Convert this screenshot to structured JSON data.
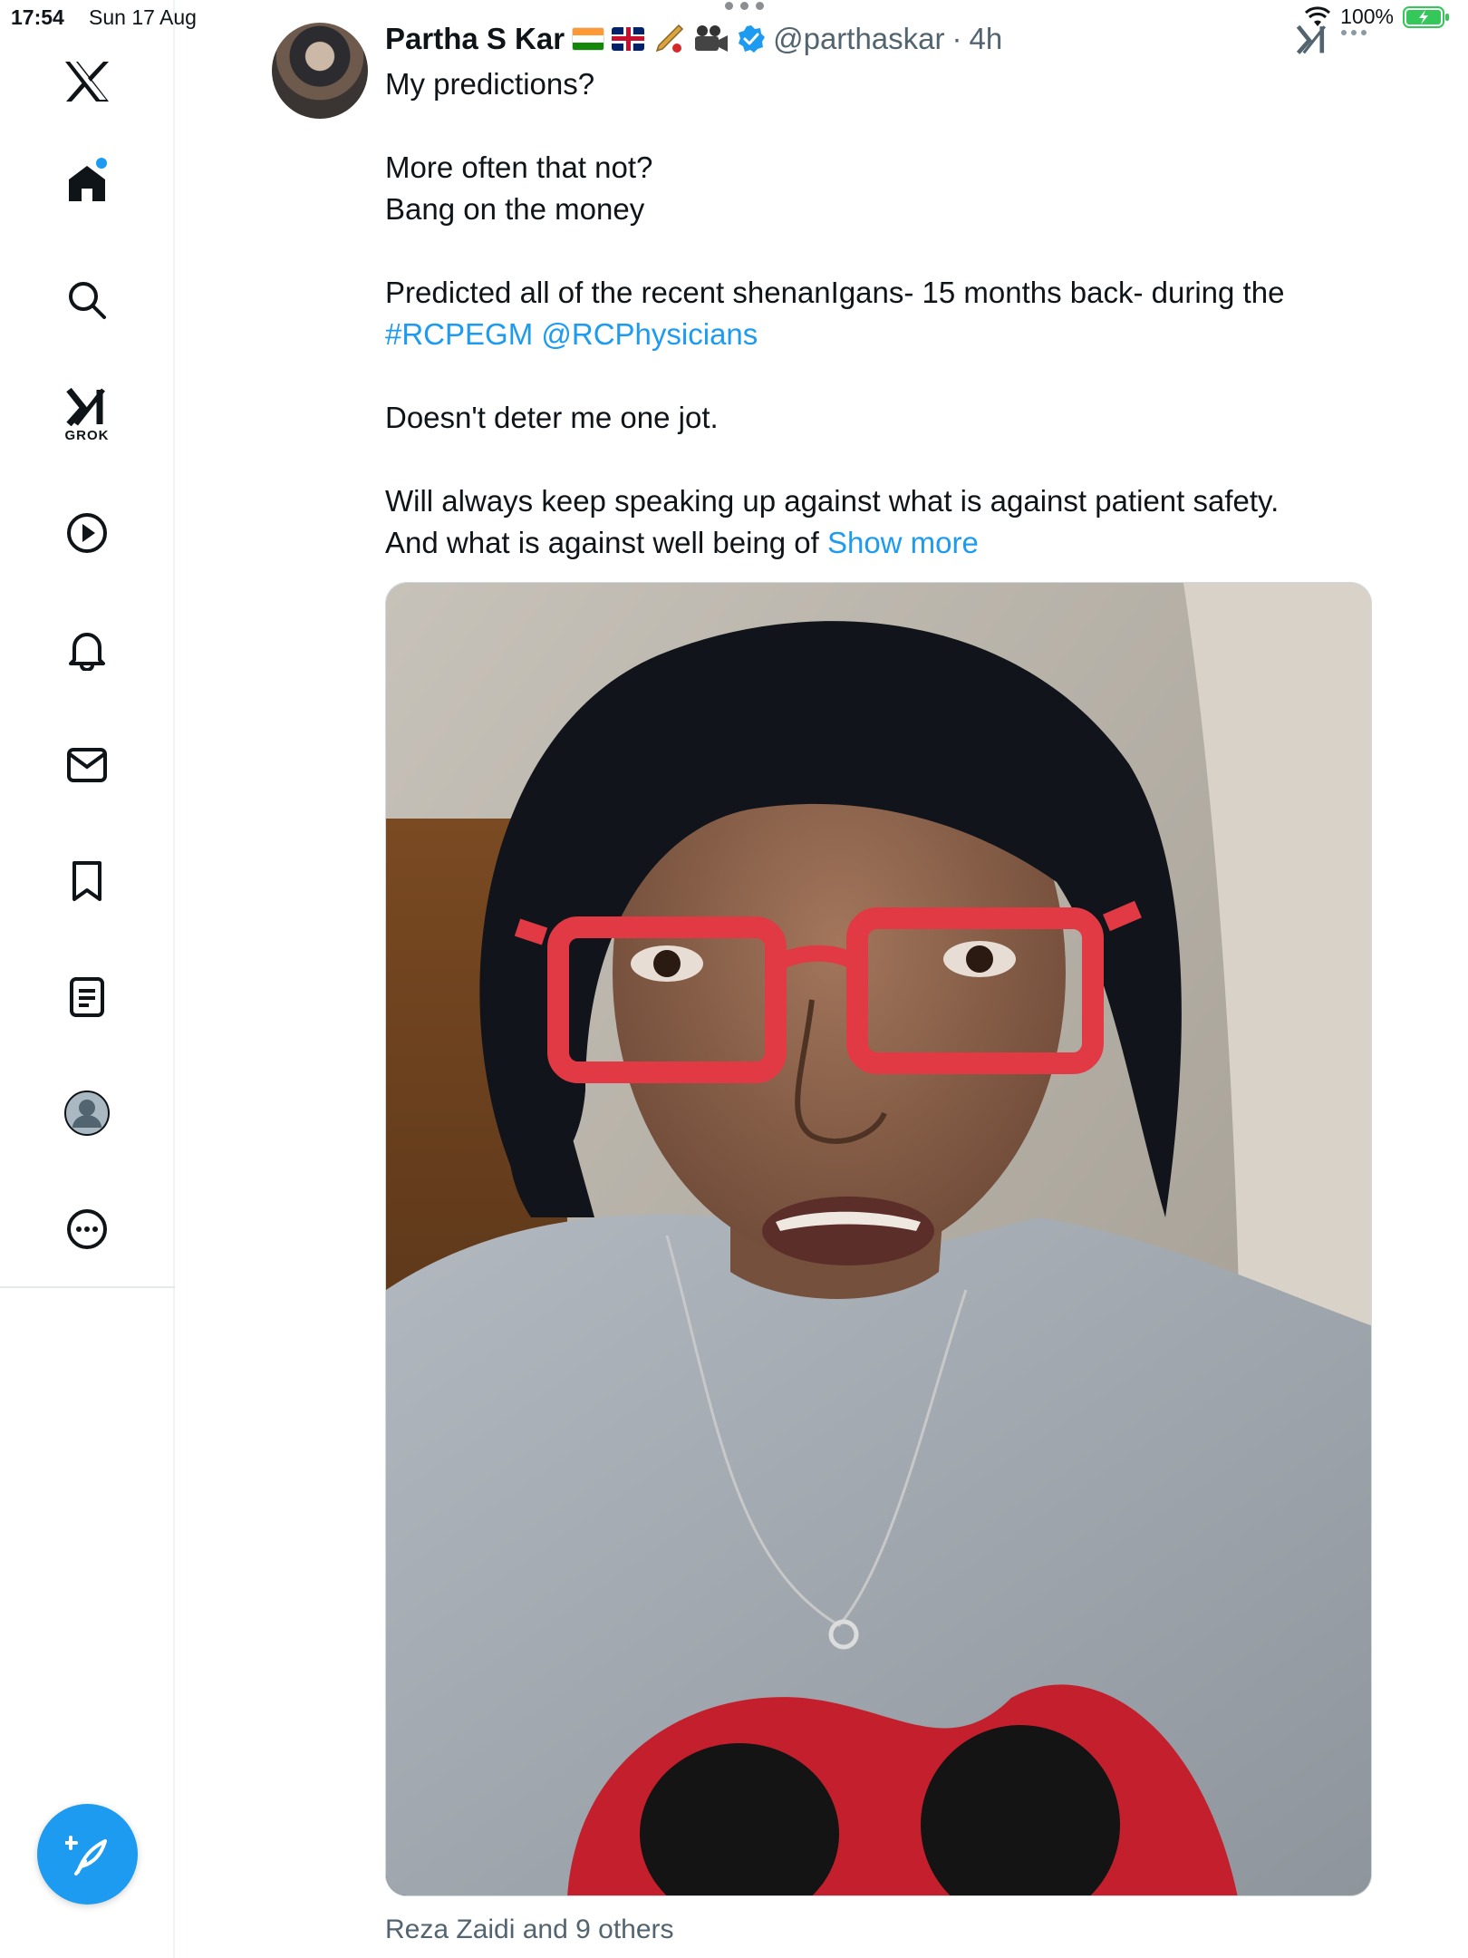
{
  "status_bar": {
    "time": "17:54",
    "date": "Sun 17 Aug",
    "battery": "100%"
  },
  "sidebar": {
    "items": [
      {
        "name": "x-logo",
        "icon": "x-logo-icon"
      },
      {
        "name": "home",
        "icon": "home-icon",
        "has_notification_dot": true
      },
      {
        "name": "search",
        "icon": "search-icon"
      },
      {
        "name": "grok",
        "icon": "grok-icon",
        "label": "GROK"
      },
      {
        "name": "video",
        "icon": "play-icon"
      },
      {
        "name": "notifications",
        "icon": "bell-icon"
      },
      {
        "name": "messages",
        "icon": "mail-icon"
      },
      {
        "name": "bookmarks",
        "icon": "bookmark-icon"
      },
      {
        "name": "lists",
        "icon": "list-icon"
      },
      {
        "name": "profile",
        "icon": "profile-icon"
      },
      {
        "name": "more",
        "icon": "more-circle-icon"
      }
    ],
    "compose_icon": "compose-feather-icon"
  },
  "tweet": {
    "display_name": "Partha S Kar",
    "handle": "@parthaskar",
    "separator": "·",
    "time_ago": "4h",
    "lines": {
      "l1": "My predictions?",
      "l2": "More often that not?",
      "l3": "Bang on the money",
      "l4": "Predicted all of the recent shenanIgans- 15 months back- during the",
      "l5_hashtag": "#RCPEGM",
      "l5_mention": "@RCPhysicians",
      "l6": "Doesn't deter me one jot.",
      "l7": "Will always keep speaking up against what is against patient safety.",
      "l8": "And what is against well being of",
      "show_more": "Show more"
    },
    "liked_by": "Reza Zaidi and 9 others"
  },
  "colors": {
    "accent": "#1d9bf0",
    "text": "#0f1419",
    "muted": "#536471"
  }
}
